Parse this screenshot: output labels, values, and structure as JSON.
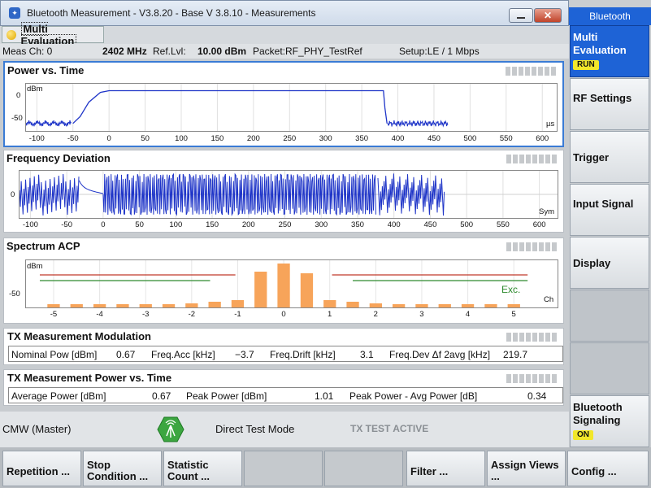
{
  "window": {
    "title": "Bluetooth Measurement  - V3.8.20 - Base V 3.8.10 - Measurements",
    "close_label": "✕"
  },
  "tab": {
    "label": "Multi Evaluation"
  },
  "info": {
    "meas_ch": "Meas Ch: 0",
    "freq": "2402 MHz",
    "reflvl_label": "Ref.Lvl:",
    "reflvl_value": "10.00 dBm",
    "packet": "Packet:RF_PHY_TestRef",
    "setup": "Setup:LE / 1 Mbps"
  },
  "power_vs_time": {
    "title": "Power vs. Time",
    "ylabel": "dBm",
    "yticks": [
      "0",
      "-50"
    ],
    "xticks": [
      "-100",
      "-50",
      "0",
      "50",
      "100",
      "150",
      "200",
      "250",
      "300",
      "350",
      "400",
      "450",
      "500",
      "550",
      "600"
    ],
    "unit": "µs",
    "chart_data": {
      "type": "line",
      "x_range": [
        -115,
        620
      ],
      "y_range": [
        -70,
        12
      ],
      "series": [
        {
          "points": [
            [
              -115,
              -57
            ],
            [
              -50,
              -57
            ],
            [
              -40,
              -45
            ],
            [
              -28,
              -20
            ],
            [
              -12,
              -3
            ],
            [
              0,
              0
            ],
            [
              380,
              0
            ],
            [
              382,
              -30
            ],
            [
              385,
              -57
            ],
            [
              470,
              -57
            ]
          ]
        }
      ]
    }
  },
  "freq_dev": {
    "title": "Frequency Deviation",
    "yticks": [
      "0"
    ],
    "xticks": [
      "-100",
      "-50",
      "0",
      "50",
      "100",
      "150",
      "200",
      "250",
      "300",
      "350",
      "400",
      "450",
      "500",
      "550",
      "600"
    ],
    "unit": "Sym",
    "chart_data": {
      "type": "line",
      "x_range": [
        -115,
        625
      ],
      "y_range": [
        -1,
        1
      ]
    }
  },
  "spectrum": {
    "title": "Spectrum ACP",
    "ylabel": "dBm",
    "yticks": [
      "-50"
    ],
    "xticks": [
      "-5",
      "-4",
      "-3",
      "-2",
      "-1",
      "0",
      "1",
      "2",
      "3",
      "4",
      "5"
    ],
    "unit": "Ch",
    "limit_label": "Exc.",
    "chart_data": {
      "type": "bar",
      "channels": [
        -5,
        -4.5,
        -4,
        -3.5,
        -3,
        -2.5,
        -2,
        -1.5,
        -1,
        -0.5,
        0,
        0.5,
        1,
        1.5,
        2,
        2.5,
        3,
        3.5,
        4,
        4.5,
        5
      ],
      "values": [
        -60,
        -60,
        -60,
        -60,
        -60,
        -60,
        -59,
        -57,
        -55,
        -20,
        -10,
        -22,
        -55,
        -57,
        -59,
        -60,
        -60,
        -60,
        -60,
        -60,
        -60
      ],
      "y_range": [
        -64,
        -6
      ],
      "limit_lines": [
        {
          "color": "#c0392b",
          "level": -24
        },
        {
          "color": "#2e8b2e",
          "level": -31
        }
      ]
    }
  },
  "tx_mod": {
    "title": "TX Measurement Modulation",
    "items": [
      {
        "label": "Nominal Pow [dBm]",
        "value": "0.67"
      },
      {
        "label": "Freq.Acc [kHz]",
        "value": "−3.7"
      },
      {
        "label": "Freq.Drift [kHz]",
        "value": "3.1"
      },
      {
        "label": "Freq.Dev Δf 2avg [kHz]",
        "value": "219.7"
      }
    ]
  },
  "tx_pvt": {
    "title": "TX Measurement Power vs. Time",
    "items": [
      {
        "label": "Average Power [dBm]",
        "value": "0.67"
      },
      {
        "label": "Peak Power [dBm]",
        "value": "1.01"
      },
      {
        "label": "Peak Power - Avg Power [dB]",
        "value": "0.34"
      }
    ]
  },
  "status": {
    "master": "CMW (Master)",
    "mode": "Direct Test Mode",
    "state": "TX TEST ACTIVE"
  },
  "sidebar": {
    "header": "Bluetooth",
    "items": [
      {
        "label": "Multi Evaluation",
        "badge": "RUN"
      },
      {
        "label": "RF Settings"
      },
      {
        "label": "Trigger"
      },
      {
        "label": "Input Signal"
      },
      {
        "label": "Display"
      },
      {
        "label": ""
      },
      {
        "label": ""
      },
      {
        "label": "Bluetooth Signaling",
        "badge": "ON"
      }
    ]
  },
  "softkeys": [
    "Repetition ...",
    "Stop Condition ...",
    "Statistic Count ...",
    "",
    "",
    "Filter ...",
    "Assign Views ...",
    "Config ..."
  ]
}
